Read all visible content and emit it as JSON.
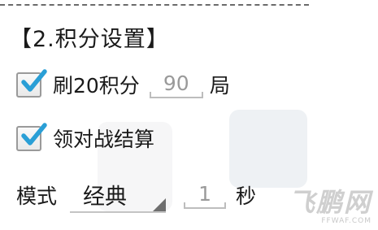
{
  "section": {
    "title": "【2.积分设置】"
  },
  "options": {
    "rounds_toggle": {
      "checked": true,
      "label": "刷20积分",
      "value": "90",
      "unit": "局"
    },
    "battle_settle": {
      "checked": true,
      "label": "领对战结算"
    }
  },
  "mode_row": {
    "label": "模式",
    "selected": "经典",
    "value": "1",
    "unit": "秒"
  },
  "watermark": {
    "main": "飞鹏网",
    "sub": "FFWAF.COM"
  },
  "colors": {
    "check": "#2a9fd6",
    "hint_text": "#9a9a9a"
  }
}
